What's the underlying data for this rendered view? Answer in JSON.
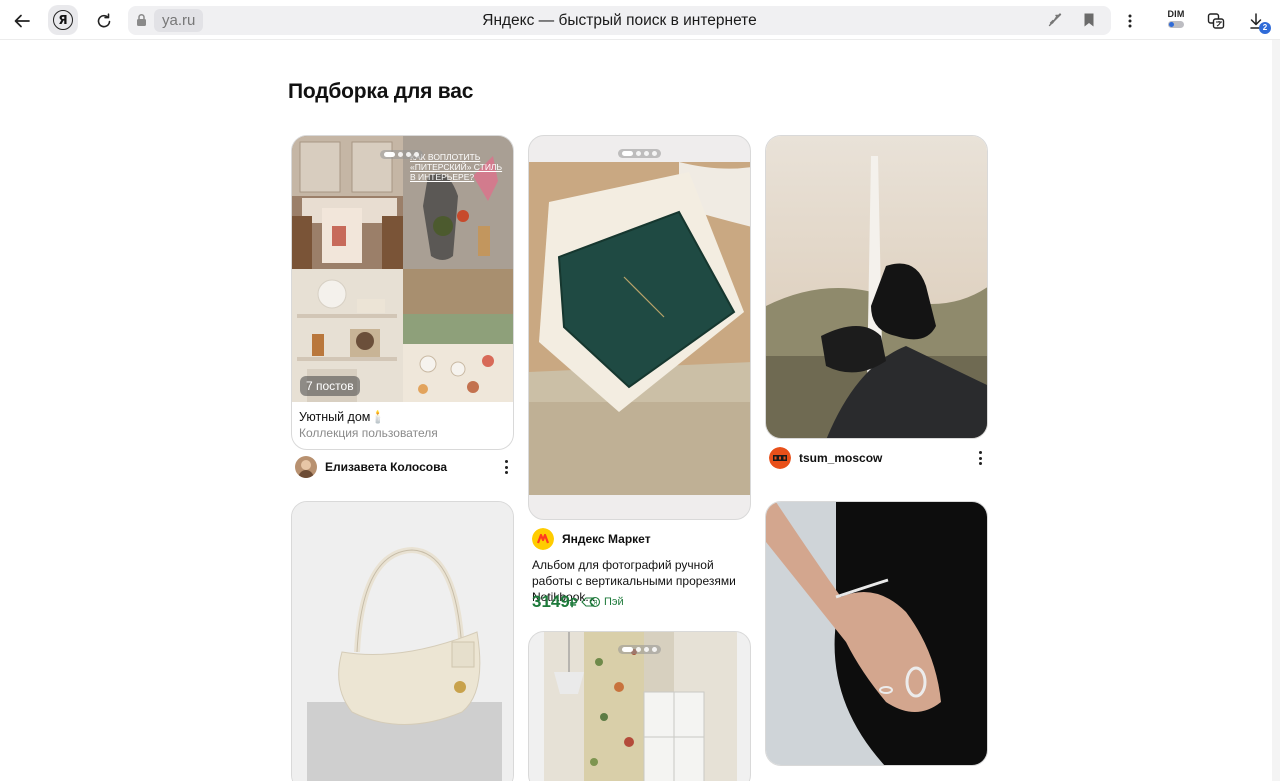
{
  "browser": {
    "domain": "ya.ru",
    "tab_title": "Яндекс — быстрый поиск в интернете",
    "yandex_button_glyph": "Я",
    "dim_label": "DIM",
    "downloads_count": "2",
    "icons": [
      "back-arrow-icon",
      "reload-icon",
      "lock-icon",
      "mic-off-icon",
      "bookmark-icon",
      "menu-dots-icon",
      "dim-toggle",
      "translate-icon",
      "download-icon"
    ]
  },
  "feed": {
    "title": "Подборка для вас",
    "collection": {
      "posts_count": "7 постов",
      "overlay_text": "Как воплотить «питерский» стиль в интерьере?",
      "title": "Уютный дом🕯️",
      "subtitle": "Коллекция пользователя",
      "author": "Елизавета Колосова"
    },
    "market": {
      "author": "Яндекс Маркет",
      "product": "Альбом для фотографий ручной работы с вертикальными прорезями Notikbook...",
      "price": "3149",
      "currency": "₽",
      "pay_label": "Пэй"
    },
    "tsum": {
      "author": "tsum_moscow"
    }
  },
  "colors": {
    "price_green": "#1e7a3b",
    "accent_blue": "#2f6bd8",
    "market_yellow": "#ffcc00",
    "market_red": "#ff3b1f",
    "tsum_orange": "#e8501a"
  }
}
